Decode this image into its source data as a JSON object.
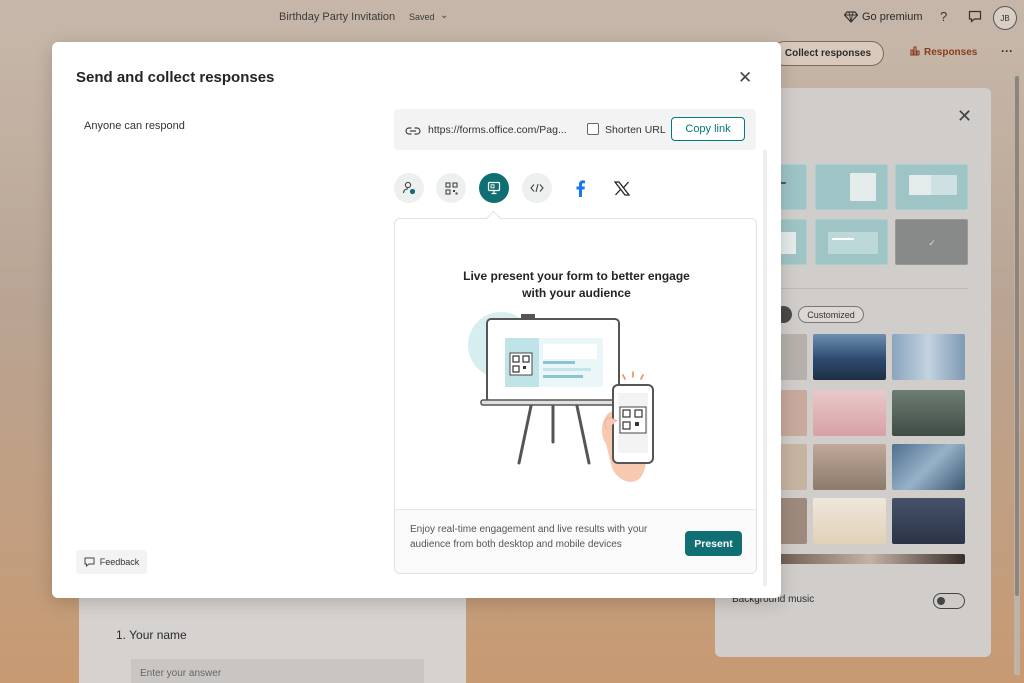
{
  "app": {
    "doc_title": "Birthday Party Invitation",
    "doc_status": "Saved",
    "go_premium": "Go premium",
    "help": "?",
    "avatar_initials": "JB",
    "collect_responses": "Collect responses",
    "responses": "Responses",
    "more": "···"
  },
  "question": {
    "title": "1. Your name",
    "placeholder": "Enter your answer"
  },
  "style_panel": {
    "filter_customized": "Customized",
    "background_music_label": "Background music",
    "background_music_on": false
  },
  "modal": {
    "title": "Send and collect responses",
    "close_icon": "close-icon",
    "audience": "Anyone can respond",
    "link_url": "https://forms.office.com/Pag...",
    "shorten_url_label": "Shorten URL",
    "shorten_url_checked": false,
    "copy_link_label": "Copy link",
    "share_options": [
      {
        "name": "invite-icon"
      },
      {
        "name": "qr-code-icon"
      },
      {
        "name": "live-present-icon",
        "active": true
      },
      {
        "name": "embed-icon"
      },
      {
        "name": "facebook-icon"
      },
      {
        "name": "x-icon"
      }
    ],
    "present_card": {
      "headline_line1": "Live present your form to better engage",
      "headline_line2": "with your audience",
      "description": "Enjoy real-time engagement and live results with your audience from both desktop and mobile devices",
      "present_label": "Present"
    },
    "feedback_label": "Feedback"
  },
  "colors": {
    "accent": "#0f6f72",
    "link_accent": "#03787c",
    "facebook": "#1877f2"
  }
}
